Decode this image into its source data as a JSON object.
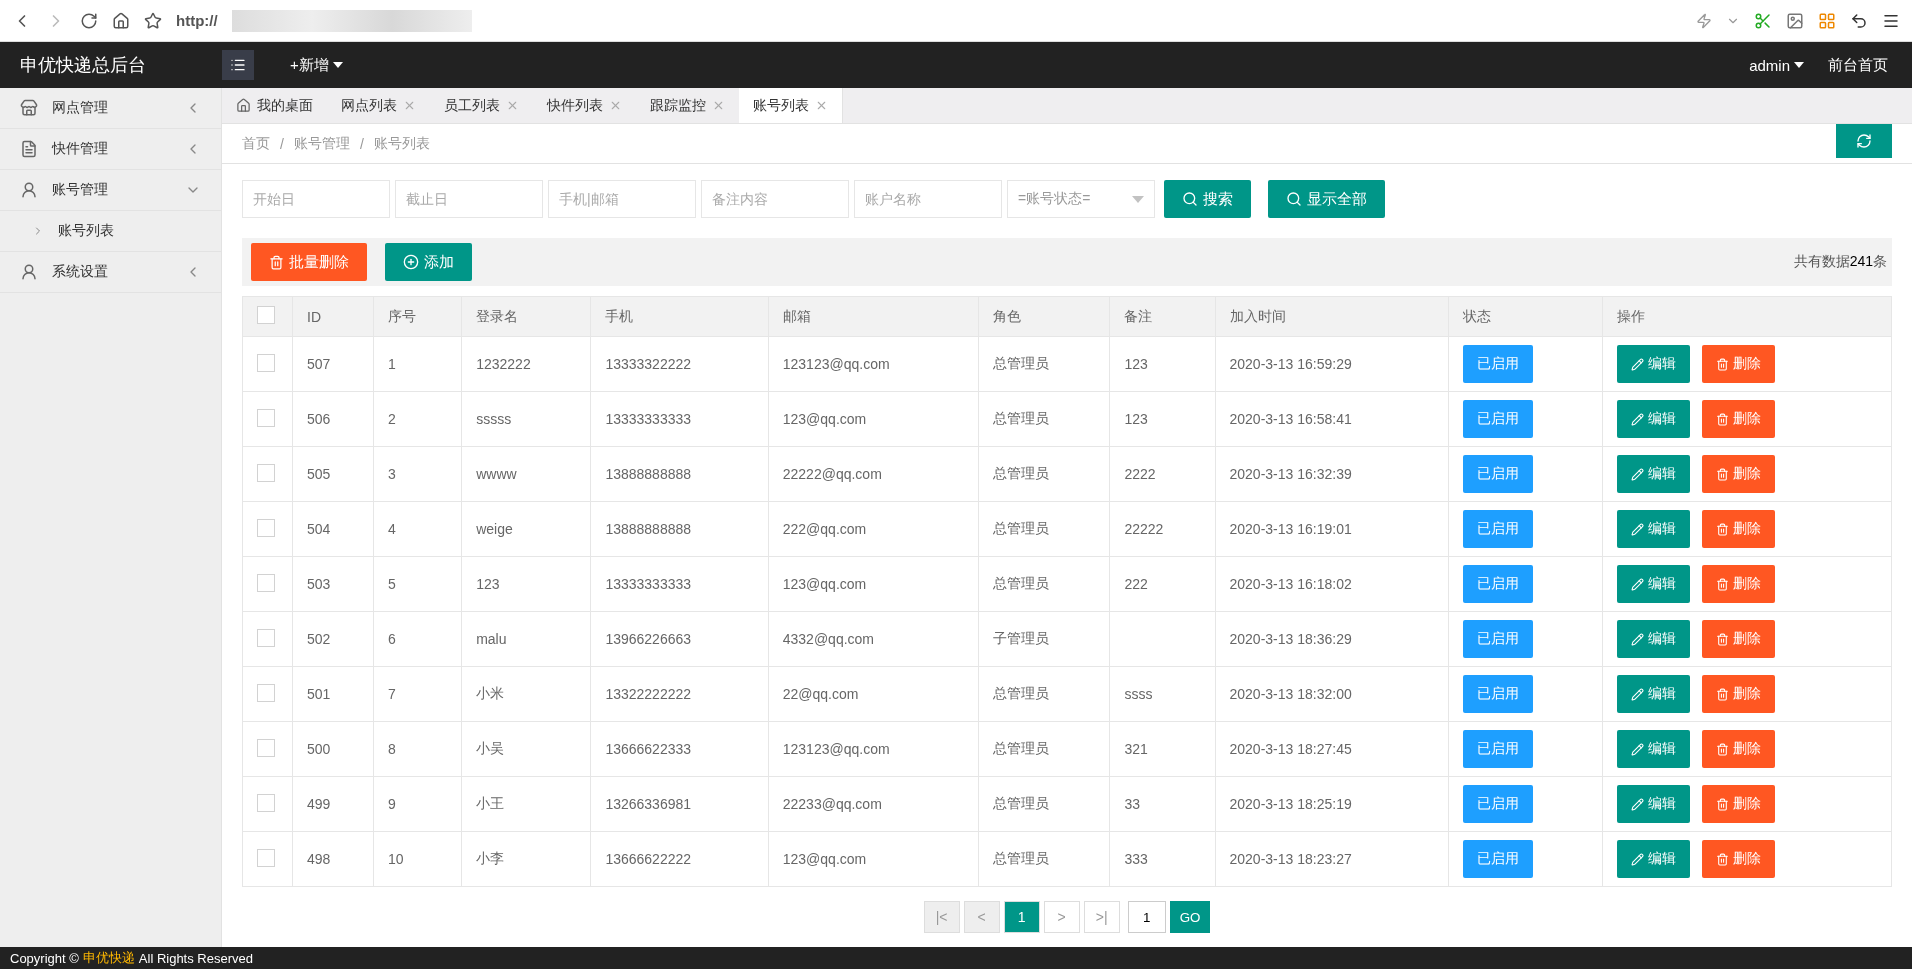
{
  "browser": {
    "address": "http://"
  },
  "header": {
    "title": "申优快递总后台",
    "new_menu": "+新增",
    "user": "admin",
    "home_link": "前台首页"
  },
  "sidebar": {
    "items": [
      {
        "label": "网点管理",
        "expanded": false
      },
      {
        "label": "快件管理",
        "expanded": false
      },
      {
        "label": "账号管理",
        "expanded": true,
        "children": [
          {
            "label": "账号列表"
          }
        ]
      },
      {
        "label": "系统设置",
        "expanded": false
      }
    ]
  },
  "tabs": [
    {
      "label": "我的桌面",
      "kind": "home",
      "selected": false
    },
    {
      "label": "网点列表",
      "kind": "closable",
      "selected": false
    },
    {
      "label": "员工列表",
      "kind": "closable",
      "selected": false
    },
    {
      "label": "快件列表",
      "kind": "closable",
      "selected": false
    },
    {
      "label": "跟踪监控",
      "kind": "closable",
      "selected": false
    },
    {
      "label": "账号列表",
      "kind": "closable",
      "selected": true
    }
  ],
  "breadcrumb": [
    "首页",
    "账号管理",
    "账号列表"
  ],
  "breadcrumb_separator": "/",
  "filters": {
    "fields": [
      {
        "placeholder": "开始日"
      },
      {
        "placeholder": "截止日"
      },
      {
        "placeholder": "手机|邮箱"
      },
      {
        "placeholder": "备注内容"
      },
      {
        "placeholder": "账户名称"
      }
    ],
    "status_select": "=账号状态=",
    "search_button": "搜索",
    "show_all_button": "显示全部"
  },
  "toolbar": {
    "batch_delete": "批量删除",
    "add": "添加",
    "total": "共有数据**241**条"
  },
  "table": {
    "select_all_checked": false,
    "columns": [
      "ID",
      "序号",
      "登录名",
      "手机",
      "邮箱",
      "角色",
      "备注",
      "加入时间",
      "状态",
      "操作"
    ],
    "rows": [
      {
        "checked": false,
        "cells": [
          "507",
          "1",
          "1232222",
          "13333322222",
          "123123@qq.com",
          "总管理员",
          "123",
          "2020-3-13 16:59:29"
        ],
        "status": "已启用",
        "edit": "编辑",
        "delete": "删除"
      },
      {
        "checked": false,
        "cells": [
          "506",
          "2",
          "sssss",
          "13333333333",
          "123@qq.com",
          "总管理员",
          "123",
          "2020-3-13 16:58:41"
        ],
        "status": "已启用",
        "edit": "编辑",
        "delete": "删除"
      },
      {
        "checked": false,
        "cells": [
          "505",
          "3",
          "wwww",
          "13888888888",
          "22222@qq.com",
          "总管理员",
          "2222",
          "2020-3-13 16:32:39"
        ],
        "status": "已启用",
        "edit": "编辑",
        "delete": "删除"
      },
      {
        "checked": false,
        "cells": [
          "504",
          "4",
          "weige",
          "13888888888",
          "222@qq.com",
          "总管理员",
          "22222",
          "2020-3-13 16:19:01"
        ],
        "status": "已启用",
        "edit": "编辑",
        "delete": "删除"
      },
      {
        "checked": false,
        "cells": [
          "503",
          "5",
          "123",
          "13333333333",
          "123@qq.com",
          "总管理员",
          "222",
          "2020-3-13 16:18:02"
        ],
        "status": "已启用",
        "edit": "编辑",
        "delete": "删除"
      },
      {
        "checked": false,
        "cells": [
          "502",
          "6",
          "malu",
          "13966226663",
          "4332@qq.com",
          "子管理员",
          "",
          "2020-3-13 18:36:29"
        ],
        "status": "已启用",
        "edit": "编辑",
        "delete": "删除"
      },
      {
        "checked": false,
        "cells": [
          "501",
          "7",
          "小米",
          "13322222222",
          "22@qq.com",
          "总管理员",
          "ssss",
          "2020-3-13 18:32:00"
        ],
        "status": "已启用",
        "edit": "编辑",
        "delete": "删除"
      },
      {
        "checked": false,
        "cells": [
          "500",
          "8",
          "小吴",
          "13666622333",
          "123123@qq.com",
          "总管理员",
          "321",
          "2020-3-13 18:27:45"
        ],
        "status": "已启用",
        "edit": "编辑",
        "delete": "删除"
      },
      {
        "checked": false,
        "cells": [
          "499",
          "9",
          "小王",
          "13266336981",
          "22233@qq.com",
          "总管理员",
          "33",
          "2020-3-13 18:25:19"
        ],
        "status": "已启用",
        "edit": "编辑",
        "delete": "删除"
      },
      {
        "checked": false,
        "cells": [
          "498",
          "10",
          "小李",
          "13666622222",
          "123@qq.com",
          "总管理员",
          "333",
          "2020-3-13 18:23:27"
        ],
        "status": "已启用",
        "edit": "编辑",
        "delete": "删除"
      }
    ]
  },
  "pagination": {
    "first": "|<",
    "prev": "<",
    "pages": [
      {
        "label": "1",
        "selected": true
      }
    ],
    "next": ">",
    "last": ">|",
    "jump_value": "1",
    "go": "GO"
  },
  "footer": {
    "prefix": "Copyright ©",
    "brand": "申优快递",
    "suffix": "All Rights Reserved"
  }
}
